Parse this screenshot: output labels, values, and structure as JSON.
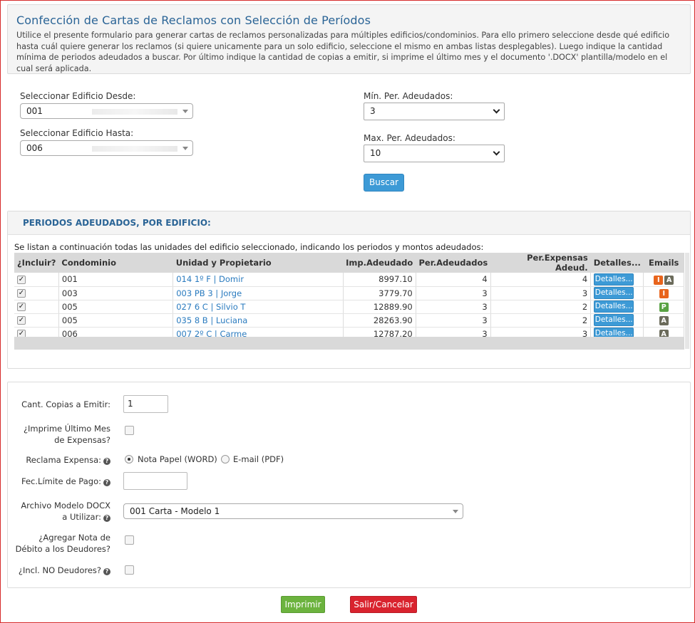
{
  "header": {
    "title": "Confección de Cartas de Reclamos con Selección de Períodos",
    "description": "Utilice el presente formulario para generar cartas de reclamos personalizadas para múltiples edificios/condominios. Para ello primero seleccione desde qué edificio hasta cuál quiere generar los reclamos (si quiere unicamente para un solo edificio, seleccione el mismo en ambas listas desplegables). Luego indique la cantidad mínima de periodos adeudados a buscar. Por último indique la cantidad de copias a emitir, si imprime el último mes y el documento '.DOCX' plantilla/modelo en el cual será aplicada."
  },
  "search": {
    "desde_label": "Seleccionar Edificio Desde:",
    "desde_value": "001",
    "hasta_label": "Seleccionar Edificio Hasta:",
    "hasta_value": "006",
    "min_label": "Mín. Per. Adeudados:",
    "min_value": "3",
    "max_label": "Max. Per. Adeudados:",
    "max_value": "10",
    "buscar_label": "Buscar"
  },
  "results": {
    "title": "PERIODOS ADEUDADOS, POR EDIFICIO:",
    "description": "Se listan a continuación todas las unidades del edificio seleccionado, indicando los periodos y montos adeudados:",
    "columns": [
      "¿Incluir?",
      "Condominio",
      "Unidad y Propietario",
      "Imp.Adeudado",
      "Per.Adeudados",
      "Per.Expensas Adeud.",
      "Detalles...",
      "Emails"
    ],
    "rows": [
      {
        "condominio": "001",
        "unidad": "014 1º F | Domir",
        "importe": "8997.10",
        "per_adeudados": "4",
        "per_expensas": "4",
        "detalles": "Detalles...",
        "emails": [
          "I",
          "A"
        ]
      },
      {
        "condominio": "003",
        "unidad": "003 PB 3 | Jorge",
        "importe": "3779.70",
        "per_adeudados": "3",
        "per_expensas": "3",
        "detalles": "Detalles...",
        "emails": [
          "I"
        ]
      },
      {
        "condominio": "005",
        "unidad": "027 6 C | Silvio T",
        "importe": "12889.90",
        "per_adeudados": "3",
        "per_expensas": "2",
        "detalles": "Detalles...",
        "emails": [
          "P"
        ]
      },
      {
        "condominio": "005",
        "unidad": "035 8 B | Luciana",
        "importe": "28263.90",
        "per_adeudados": "3",
        "per_expensas": "2",
        "detalles": "Detalles...",
        "emails": [
          "A"
        ]
      },
      {
        "condominio": "006",
        "unidad": "007 2º C | Carme",
        "importe": "12787.20",
        "per_adeudados": "3",
        "per_expensas": "3",
        "detalles": "Detalles...",
        "emails": [
          "A"
        ]
      }
    ]
  },
  "options": {
    "copias_label": "Cant. Copias a Emitir:",
    "copias_value": "1",
    "ultimo_mes_label_1": "¿Imprime Último Mes",
    "ultimo_mes_label_2": "de Expensas?",
    "reclama_label": "Reclama Expensa:",
    "radio_word": "Nota Papel (WORD)",
    "radio_email": "E-mail (PDF)",
    "fec_limite_label": "Fec.Límite de Pago:",
    "fec_limite_value": "",
    "archivo_label_1": "Archivo Modelo DOCX",
    "archivo_label_2": "a Utilizar:",
    "archivo_value": "001 Carta - Modelo 1",
    "nota_debito_label_1": "¿Agregar Nota de",
    "nota_debito_label_2": "Débito a los Deudores?",
    "no_deudores_label": "¿Incl. NO Deudores?"
  },
  "actions": {
    "imprimir": "Imprimir",
    "cancelar": "Salir/Cancelar"
  },
  "colors": {
    "accent_blue": "#3d9ad6",
    "title_blue": "#2a6496",
    "green": "#6cb33e",
    "red": "#d9232e"
  },
  "icons": {
    "help": "question-circle-icon",
    "check": "checkmark-icon",
    "caret": "caret-down-icon"
  }
}
